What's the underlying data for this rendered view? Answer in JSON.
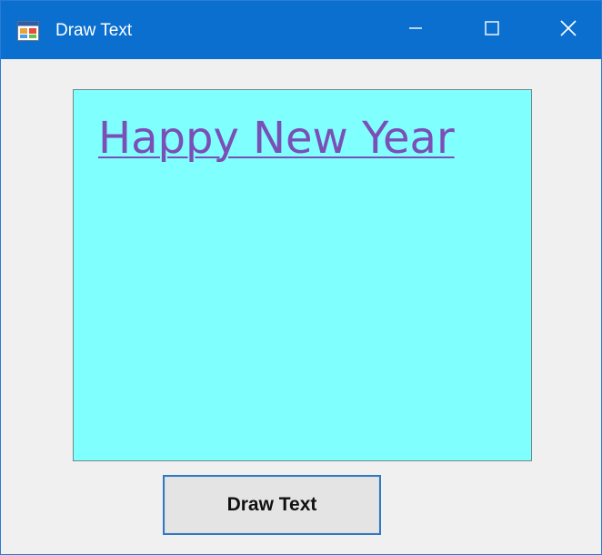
{
  "window": {
    "title": "Draw Text",
    "icon": "application-icon"
  },
  "caption_buttons": {
    "minimize": "minimize-icon",
    "maximize": "maximize-icon",
    "close": "close-icon"
  },
  "canvas": {
    "background_color": "#80ffff",
    "text": "Happy New Year",
    "text_color": "#7a4fb6"
  },
  "button": {
    "label": "Draw Text"
  }
}
